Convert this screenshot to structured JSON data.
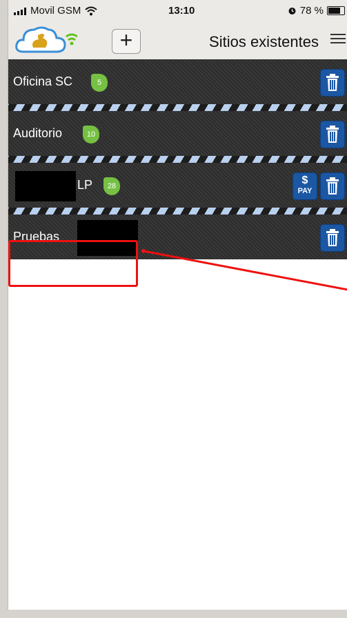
{
  "status_bar": {
    "carrier": "Movil GSM",
    "time": "13:10",
    "battery": "78 %",
    "battery_level": 0.78,
    "icons": [
      "signal-icon",
      "wifi-icon",
      "alarm-icon",
      "battery-icon"
    ]
  },
  "header": {
    "logo": "swan-cloud-logo",
    "add_label": "+",
    "title": "Sitios existentes",
    "menu_icon": "hamburger-icon"
  },
  "sites": [
    {
      "name": "Oficina SC",
      "badge": "5",
      "pay": false
    },
    {
      "name": "Auditorio",
      "badge": "10",
      "pay": false
    },
    {
      "name": "LP",
      "badge": "28",
      "pay": true,
      "pay_dollar": "$",
      "pay_text": "PAY"
    },
    {
      "name": "Pruebas",
      "badge": "",
      "pay": false
    }
  ],
  "colors": {
    "row_bg": "#2d2d2d",
    "badge": "#76c043",
    "button": "#1b57a3",
    "stripe": "#b9d0ee",
    "highlight": "#e11111"
  }
}
